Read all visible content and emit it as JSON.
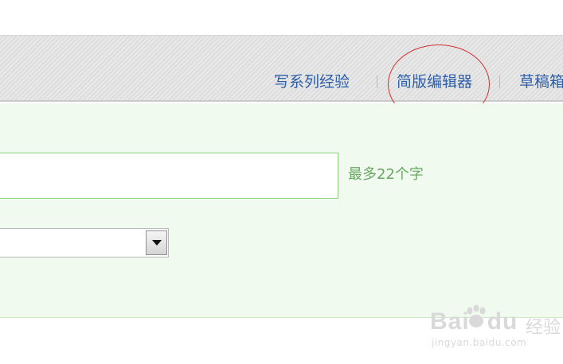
{
  "toolbar": {
    "links": [
      {
        "label": "写系列经验"
      },
      {
        "label": "简版编辑器"
      },
      {
        "label": "草稿箱"
      }
    ]
  },
  "form": {
    "title_input": {
      "value": "",
      "placeholder": ""
    },
    "title_hint": "最多22个字",
    "category_select": {
      "value": ""
    }
  },
  "watermark": {
    "brand_left": "Bai",
    "brand_right": "du",
    "product": "经验",
    "url": "jingyan.baidu.com"
  },
  "colors": {
    "link": "#2d5fa8",
    "highlight": "#d63030",
    "form_bg": "#f1faef",
    "input_border": "#8fcf80",
    "hint": "#6aa765"
  }
}
